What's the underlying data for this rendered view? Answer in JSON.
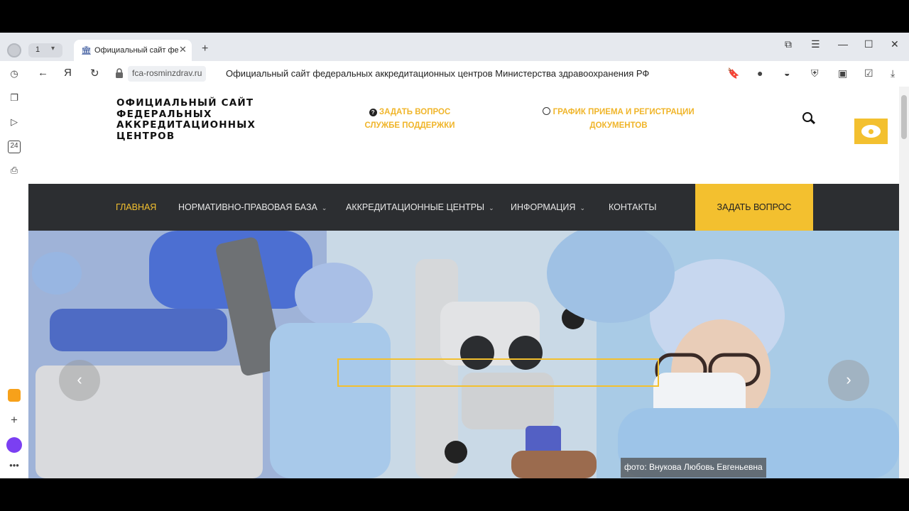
{
  "browser": {
    "tab_count": "1",
    "tab_title": "Официальный сайт фе,",
    "domain": "fca-rosminzdrav.ru",
    "page_heading": "Официальный сайт федеральных аккредитационных центров Министерства здравоохранения РФ"
  },
  "header": {
    "site_title": "ОФИЦИАЛЬНЫЙ САЙТ ФЕДЕРАЛЬНЫХ АККРЕДИТАЦИОННЫХ ЦЕНТРОВ",
    "help_line1": "ЗАДАТЬ ВОПРОС",
    "help_line2": "СЛУЖБЕ ПОДДЕРЖКИ",
    "schedule_line1": "ГРАФИК ПРИЕМА И РЕГИСТРАЦИИ",
    "schedule_line2": "ДОКУМЕНТОВ"
  },
  "nav": {
    "items": [
      {
        "label": "ГЛАВНАЯ"
      },
      {
        "label": "НОРМАТИВНО-ПРАВОВАЯ БАЗА"
      },
      {
        "label": "АККРЕДИТАЦИОННЫЕ ЦЕНТРЫ"
      },
      {
        "label": "ИНФОРМАЦИЯ"
      },
      {
        "label": "КОНТАКТЫ"
      }
    ],
    "ask_button": "ЗАДАТЬ ВОПРОС"
  },
  "hero": {
    "caption": "фото: Внукова Любовь Евгеньевна",
    "prev_arrow": "‹",
    "next_arrow": "›"
  },
  "colors": {
    "accent": "#f3c02f",
    "navbar": "#2c2e31"
  }
}
